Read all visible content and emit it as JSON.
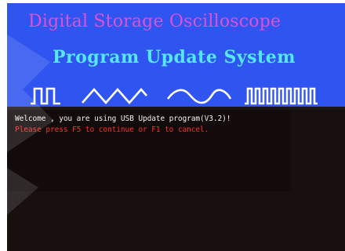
{
  "banner": {
    "title": "Digital Storage Oscilloscope",
    "subtitle": "Program Update System",
    "waveform_icons": [
      "square-wave-icon",
      "triangle-wave-icon",
      "sine-wave-icon",
      "pulse-train-icon"
    ]
  },
  "console": {
    "welcome_message": "Welcome , you are using USB Update program(V3.2)!",
    "instruction": "Please press  F5 to continue or F1  to cancel."
  },
  "colors": {
    "banner_background": "#2f54f0",
    "title": "#e24fd3",
    "subtitle": "#54e8f0",
    "console_background": "#180f0f",
    "welcome_text": "#f2f2f2",
    "instruction_text": "#ff2d2d"
  }
}
